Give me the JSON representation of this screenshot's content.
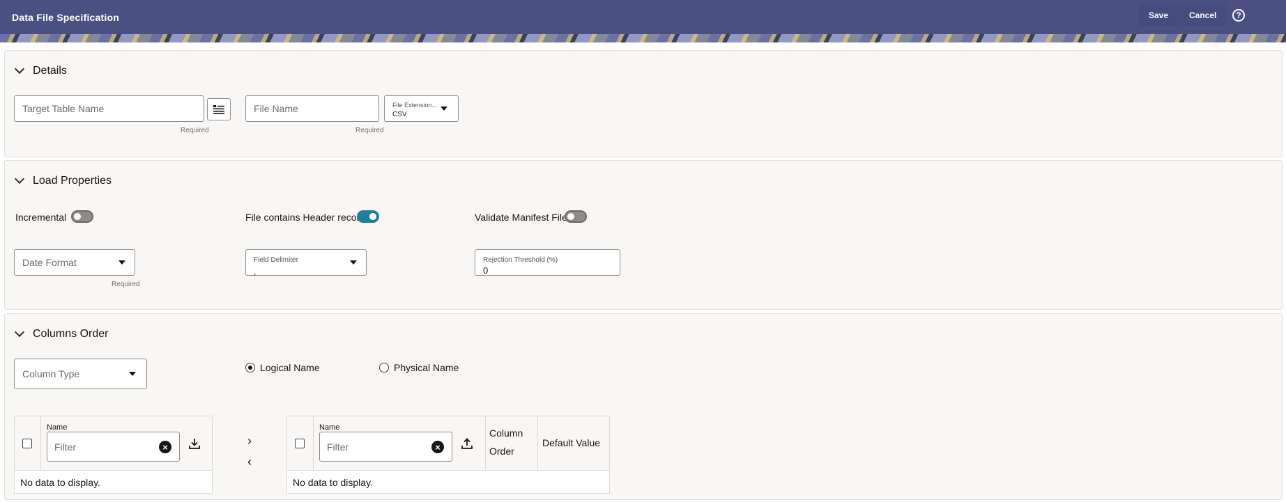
{
  "header": {
    "title": "Data File Specification",
    "save_label": "Save",
    "cancel_label": "Cancel",
    "help_icon": "?"
  },
  "details": {
    "title": "Details",
    "target_table": {
      "placeholder": "Target Table Name",
      "hint": "Required"
    },
    "file_name": {
      "placeholder": "File Name",
      "hint": "Required"
    },
    "file_extension": {
      "label": "File Extension...",
      "value": "CSV"
    }
  },
  "load_properties": {
    "title": "Load Properties",
    "incremental": {
      "label": "Incremental",
      "on": false
    },
    "header_record": {
      "label": "File contains Header record",
      "on": true
    },
    "validate_manifest": {
      "label": "Validate Manifest File",
      "on": false
    },
    "date_format": {
      "placeholder": "Date Format",
      "hint": "Required"
    },
    "field_delimiter": {
      "label": "Field Delimiter",
      "value": ","
    },
    "rejection_threshold": {
      "label": "Rejection Threshold (%)",
      "value": "0"
    }
  },
  "columns_order": {
    "title": "Columns Order",
    "column_type": {
      "placeholder": "Column Type"
    },
    "name_mode": {
      "options": [
        "Logical Name",
        "Physical Name"
      ],
      "selected": "Logical Name"
    },
    "left_table": {
      "name_header": "Name",
      "filter_placeholder": "Filter",
      "empty_text": "No data to display."
    },
    "right_table": {
      "name_header": "Name",
      "filter_placeholder": "Filter",
      "column_order_header": "Column Order",
      "default_value_header": "Default Value",
      "empty_text": "No data to display."
    },
    "move_right": "›",
    "move_left": "‹"
  }
}
